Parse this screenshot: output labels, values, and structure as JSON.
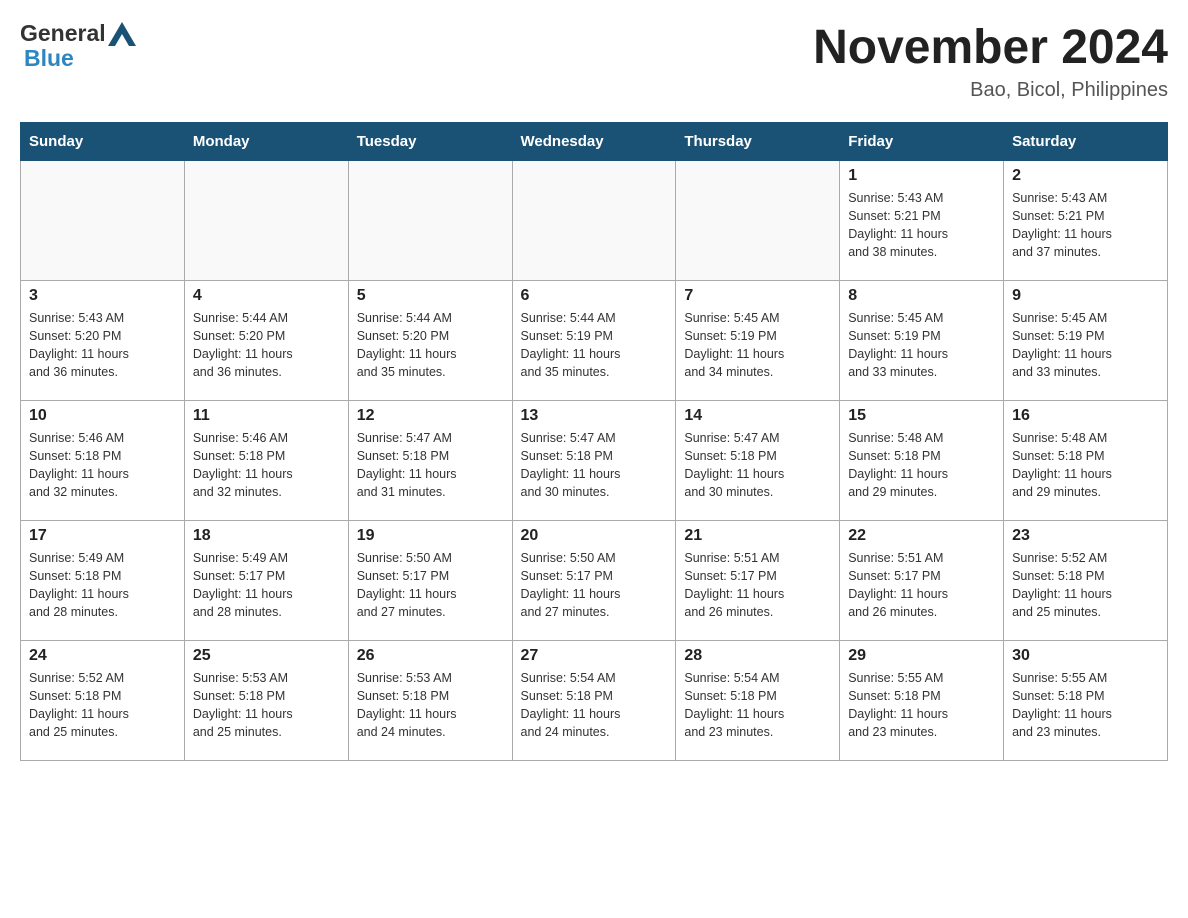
{
  "header": {
    "title": "November 2024",
    "subtitle": "Bao, Bicol, Philippines",
    "logo_general": "General",
    "logo_blue": "Blue"
  },
  "weekdays": [
    "Sunday",
    "Monday",
    "Tuesday",
    "Wednesday",
    "Thursday",
    "Friday",
    "Saturday"
  ],
  "weeks": [
    [
      {
        "day": "",
        "info": ""
      },
      {
        "day": "",
        "info": ""
      },
      {
        "day": "",
        "info": ""
      },
      {
        "day": "",
        "info": ""
      },
      {
        "day": "",
        "info": ""
      },
      {
        "day": "1",
        "info": "Sunrise: 5:43 AM\nSunset: 5:21 PM\nDaylight: 11 hours\nand 38 minutes."
      },
      {
        "day": "2",
        "info": "Sunrise: 5:43 AM\nSunset: 5:21 PM\nDaylight: 11 hours\nand 37 minutes."
      }
    ],
    [
      {
        "day": "3",
        "info": "Sunrise: 5:43 AM\nSunset: 5:20 PM\nDaylight: 11 hours\nand 36 minutes."
      },
      {
        "day": "4",
        "info": "Sunrise: 5:44 AM\nSunset: 5:20 PM\nDaylight: 11 hours\nand 36 minutes."
      },
      {
        "day": "5",
        "info": "Sunrise: 5:44 AM\nSunset: 5:20 PM\nDaylight: 11 hours\nand 35 minutes."
      },
      {
        "day": "6",
        "info": "Sunrise: 5:44 AM\nSunset: 5:19 PM\nDaylight: 11 hours\nand 35 minutes."
      },
      {
        "day": "7",
        "info": "Sunrise: 5:45 AM\nSunset: 5:19 PM\nDaylight: 11 hours\nand 34 minutes."
      },
      {
        "day": "8",
        "info": "Sunrise: 5:45 AM\nSunset: 5:19 PM\nDaylight: 11 hours\nand 33 minutes."
      },
      {
        "day": "9",
        "info": "Sunrise: 5:45 AM\nSunset: 5:19 PM\nDaylight: 11 hours\nand 33 minutes."
      }
    ],
    [
      {
        "day": "10",
        "info": "Sunrise: 5:46 AM\nSunset: 5:18 PM\nDaylight: 11 hours\nand 32 minutes."
      },
      {
        "day": "11",
        "info": "Sunrise: 5:46 AM\nSunset: 5:18 PM\nDaylight: 11 hours\nand 32 minutes."
      },
      {
        "day": "12",
        "info": "Sunrise: 5:47 AM\nSunset: 5:18 PM\nDaylight: 11 hours\nand 31 minutes."
      },
      {
        "day": "13",
        "info": "Sunrise: 5:47 AM\nSunset: 5:18 PM\nDaylight: 11 hours\nand 30 minutes."
      },
      {
        "day": "14",
        "info": "Sunrise: 5:47 AM\nSunset: 5:18 PM\nDaylight: 11 hours\nand 30 minutes."
      },
      {
        "day": "15",
        "info": "Sunrise: 5:48 AM\nSunset: 5:18 PM\nDaylight: 11 hours\nand 29 minutes."
      },
      {
        "day": "16",
        "info": "Sunrise: 5:48 AM\nSunset: 5:18 PM\nDaylight: 11 hours\nand 29 minutes."
      }
    ],
    [
      {
        "day": "17",
        "info": "Sunrise: 5:49 AM\nSunset: 5:18 PM\nDaylight: 11 hours\nand 28 minutes."
      },
      {
        "day": "18",
        "info": "Sunrise: 5:49 AM\nSunset: 5:17 PM\nDaylight: 11 hours\nand 28 minutes."
      },
      {
        "day": "19",
        "info": "Sunrise: 5:50 AM\nSunset: 5:17 PM\nDaylight: 11 hours\nand 27 minutes."
      },
      {
        "day": "20",
        "info": "Sunrise: 5:50 AM\nSunset: 5:17 PM\nDaylight: 11 hours\nand 27 minutes."
      },
      {
        "day": "21",
        "info": "Sunrise: 5:51 AM\nSunset: 5:17 PM\nDaylight: 11 hours\nand 26 minutes."
      },
      {
        "day": "22",
        "info": "Sunrise: 5:51 AM\nSunset: 5:17 PM\nDaylight: 11 hours\nand 26 minutes."
      },
      {
        "day": "23",
        "info": "Sunrise: 5:52 AM\nSunset: 5:18 PM\nDaylight: 11 hours\nand 25 minutes."
      }
    ],
    [
      {
        "day": "24",
        "info": "Sunrise: 5:52 AM\nSunset: 5:18 PM\nDaylight: 11 hours\nand 25 minutes."
      },
      {
        "day": "25",
        "info": "Sunrise: 5:53 AM\nSunset: 5:18 PM\nDaylight: 11 hours\nand 25 minutes."
      },
      {
        "day": "26",
        "info": "Sunrise: 5:53 AM\nSunset: 5:18 PM\nDaylight: 11 hours\nand 24 minutes."
      },
      {
        "day": "27",
        "info": "Sunrise: 5:54 AM\nSunset: 5:18 PM\nDaylight: 11 hours\nand 24 minutes."
      },
      {
        "day": "28",
        "info": "Sunrise: 5:54 AM\nSunset: 5:18 PM\nDaylight: 11 hours\nand 23 minutes."
      },
      {
        "day": "29",
        "info": "Sunrise: 5:55 AM\nSunset: 5:18 PM\nDaylight: 11 hours\nand 23 minutes."
      },
      {
        "day": "30",
        "info": "Sunrise: 5:55 AM\nSunset: 5:18 PM\nDaylight: 11 hours\nand 23 minutes."
      }
    ]
  ]
}
